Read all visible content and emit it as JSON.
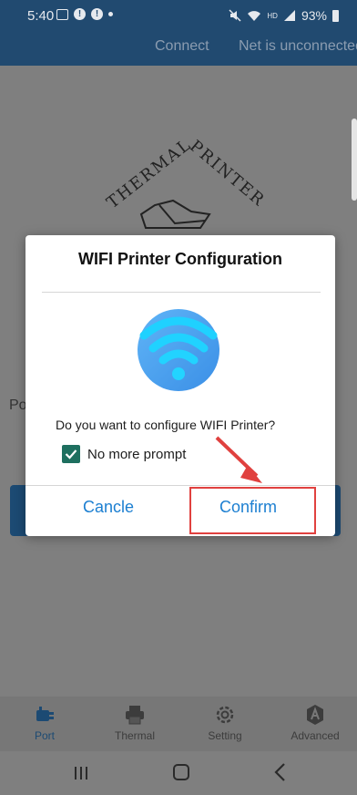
{
  "status_bar": {
    "time": "5:40",
    "battery": "93%",
    "network_type": "HD"
  },
  "header": {
    "connect_label": "Connect",
    "net_status": "Net is unconnected"
  },
  "background": {
    "logo_text_left": "THERMAL",
    "logo_text_right": "PRINTER",
    "partial_label": "Po"
  },
  "dialog": {
    "title": "WIFI Printer Configuration",
    "question": "Do you want to configure WIFI Printer?",
    "checkbox_label": "No more prompt",
    "checkbox_checked": true,
    "cancel_label": "Cancle",
    "confirm_label": "Confirm"
  },
  "bottom_nav": {
    "items": [
      {
        "label": "Port",
        "icon": "plug-icon",
        "active": true
      },
      {
        "label": "Thermal",
        "icon": "printer-icon",
        "active": false
      },
      {
        "label": "Setting",
        "icon": "gear-icon",
        "active": false
      },
      {
        "label": "Advanced",
        "icon": "advanced-icon",
        "active": false
      }
    ]
  },
  "colors": {
    "accent_blue": "#1c7fd1",
    "app_blue": "#214a70",
    "check_green": "#1e6f5f",
    "highlight_red": "#e0413f"
  }
}
